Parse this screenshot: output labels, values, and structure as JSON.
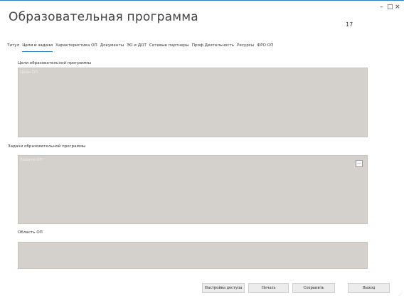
{
  "window": {
    "title": "Образовательная программа",
    "record_number": "17",
    "minimize": "–",
    "maximize": "□",
    "close": "×"
  },
  "tabs": [
    {
      "label": "Титул",
      "active": false
    },
    {
      "label": "Цели и задачи",
      "active": true
    },
    {
      "label": "Характеристика ОП",
      "active": false
    },
    {
      "label": "Документы",
      "active": false
    },
    {
      "label": "ЭО и ДОТ",
      "active": false
    },
    {
      "label": "Сетевые партнеры",
      "active": false
    },
    {
      "label": "Проф.Деятельность",
      "active": false
    },
    {
      "label": "Ресурсы",
      "active": false
    },
    {
      "label": "ФРО ОП",
      "active": false
    }
  ],
  "sections": {
    "goals": {
      "label": "Цели образовательной программы",
      "placeholder": "Цели ОП"
    },
    "tasks": {
      "label": "Задачи образовательной программы",
      "placeholder": "Задачи ОП",
      "button": "..."
    },
    "area": {
      "label": "Область ОП",
      "placeholder": ""
    }
  },
  "buttons": {
    "access": "Настройка доступа",
    "print": "Печать",
    "save": "Сохранить",
    "exit": "Выход"
  },
  "colors": {
    "accent": "#2a7fbf",
    "field_bg": "#d4d0cb"
  }
}
